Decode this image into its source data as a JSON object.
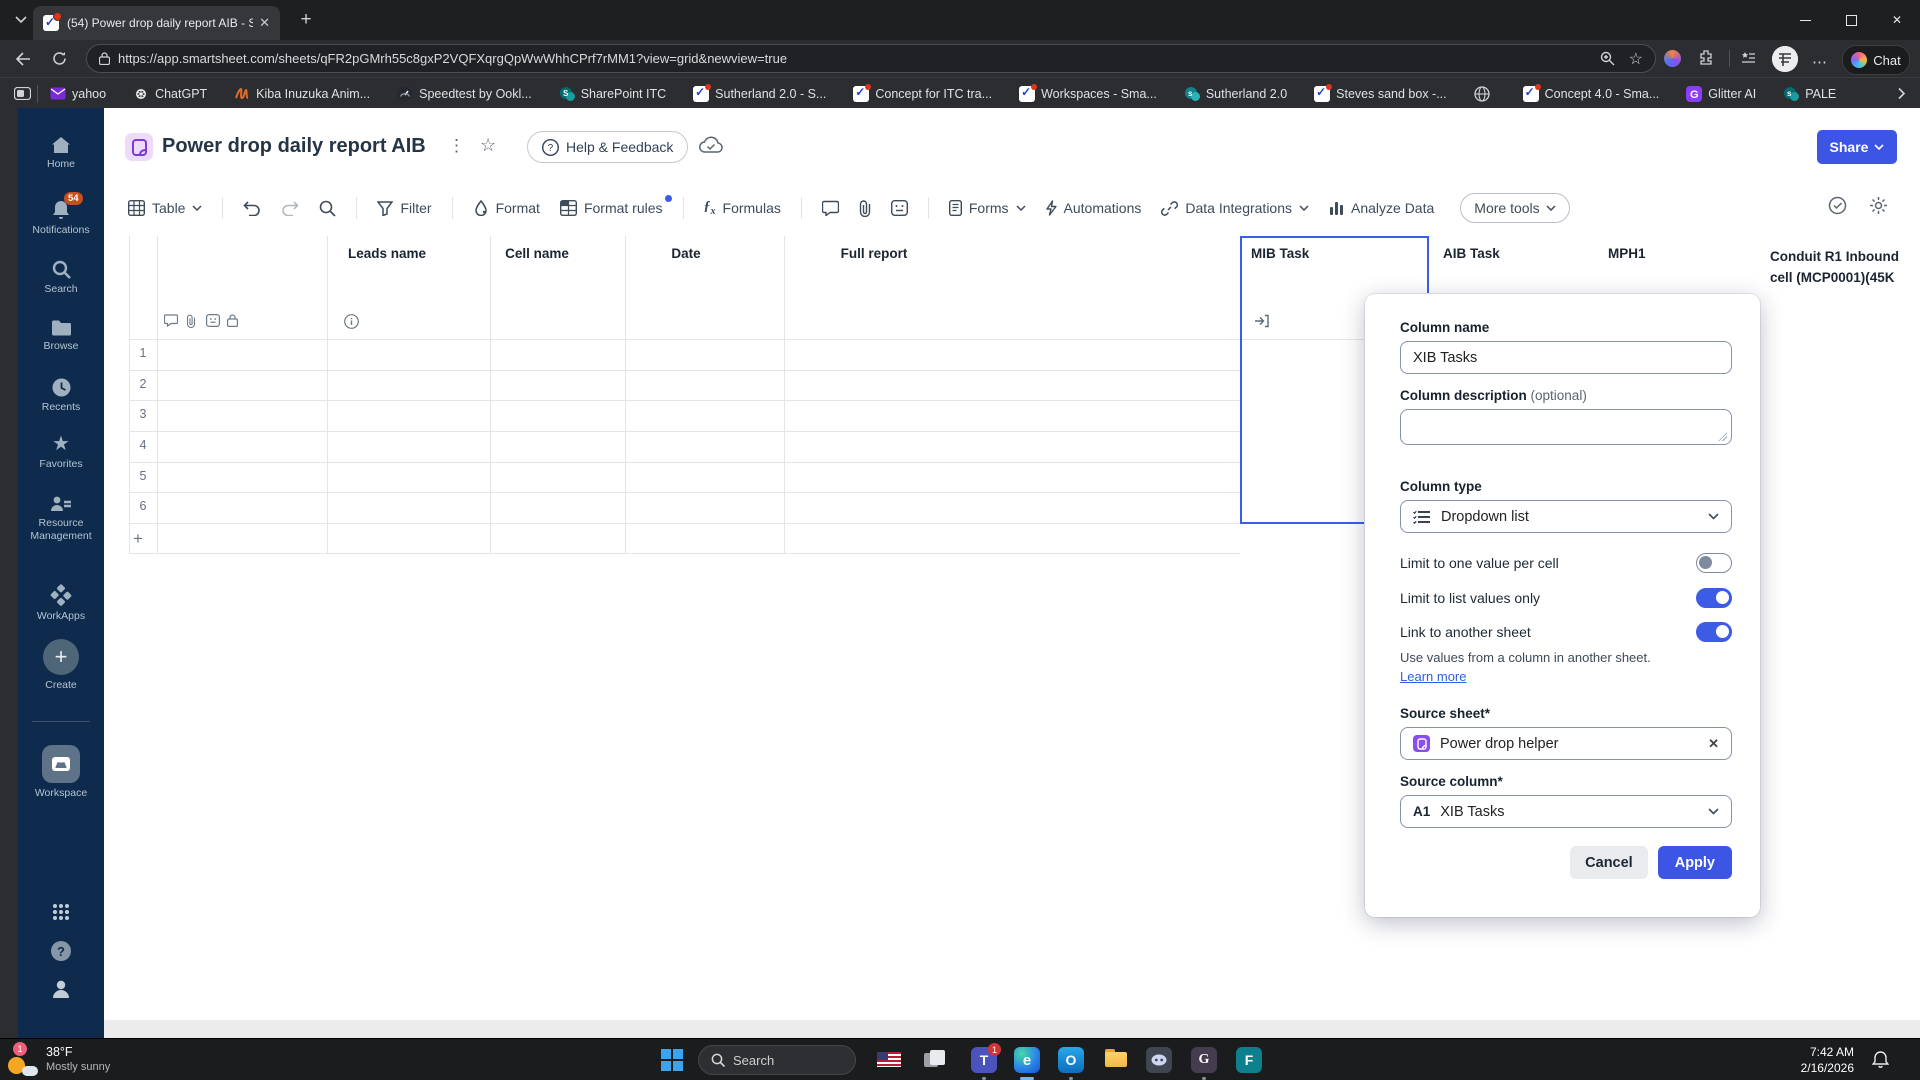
{
  "browser": {
    "tab_title": "(54) Power drop daily report AIB - S",
    "url": "https://app.smartsheet.com/sheets/qFR2pGMrh55c8gxP2VQFXqrgQpWwWhhCPrf7rMM1?view=grid&newview=true",
    "chat_label": "Chat",
    "bookmarks": [
      {
        "label": "yahoo"
      },
      {
        "label": "ChatGPT"
      },
      {
        "label": "Kiba Inuzuka Anim..."
      },
      {
        "label": "Speedtest by Ookl..."
      },
      {
        "label": "SharePoint ITC"
      },
      {
        "label": "Sutherland 2.0 - S..."
      },
      {
        "label": "Concept for ITC tra..."
      },
      {
        "label": "Workspaces - Sma..."
      },
      {
        "label": "Sutherland 2.0"
      },
      {
        "label": "Steves sand box -..."
      },
      {
        "label": ""
      },
      {
        "label": "Concept 4.0 - Sma..."
      },
      {
        "label": "Glitter AI"
      },
      {
        "label": "PALE"
      }
    ]
  },
  "sidebar": {
    "notification_count": "54",
    "items": [
      {
        "label": "Home"
      },
      {
        "label": "Notifications"
      },
      {
        "label": "Search"
      },
      {
        "label": "Browse"
      },
      {
        "label": "Recents"
      },
      {
        "label": "Favorites"
      },
      {
        "label": "Resource Management"
      },
      {
        "label": "WorkApps"
      },
      {
        "label": "Create"
      },
      {
        "label": "Workspace"
      }
    ]
  },
  "header": {
    "title": "Power drop daily report AIB",
    "help_feedback_label": "Help & Feedback",
    "share_label": "Share"
  },
  "toolbar": {
    "table_label": "Table",
    "filter_label": "Filter",
    "format_label": "Format",
    "format_rules_label": "Format rules",
    "formulas_label": "Formulas",
    "forms_label": "Forms",
    "automations_label": "Automations",
    "data_integrations_label": "Data Integrations",
    "analyze_data_label": "Analyze Data",
    "more_tools_label": "More tools"
  },
  "grid": {
    "columns": [
      "Leads name",
      "Cell name",
      "Date",
      "Full report",
      "MIB Task",
      "AIB Task",
      "MPH1",
      "Conduit R1 Inbound cell (MCP0001)(45K"
    ],
    "selected_column": "MIB Task",
    "row_numbers": [
      "1",
      "2",
      "3",
      "4",
      "5",
      "6"
    ],
    "add_row_label": "+"
  },
  "dialog": {
    "column_name_label": "Column name",
    "column_name_value": "XIB Tasks",
    "column_description_label": "Column description",
    "column_description_optional": "(optional)",
    "column_description_value": "",
    "column_type_label": "Column type",
    "column_type_value": "Dropdown list",
    "limit_one_label": "Limit to one value per cell",
    "limit_one_on": false,
    "limit_list_label": "Limit to list values only",
    "limit_list_on": true,
    "link_sheet_label": "Link to another sheet",
    "link_sheet_on": true,
    "link_sheet_help": "Use values from a column in another sheet.",
    "learn_more_label": "Learn more",
    "source_sheet_label": "Source sheet*",
    "source_sheet_value": "Power drop helper",
    "source_column_label": "Source column*",
    "source_column_badge": "A1",
    "source_column_value": "XIB Tasks",
    "cancel_label": "Cancel",
    "apply_label": "Apply"
  },
  "taskbar": {
    "temperature": "38°F",
    "condition": "Mostly sunny",
    "weather_badge": "1",
    "search_placeholder": "Search",
    "teams_badge": "1",
    "time": "7:42 AM",
    "date": "2/16/2026"
  },
  "colors": {
    "accent_blue": "#3c55e5",
    "sidebar_navy": "#0e2b4d",
    "selection_blue": "#3a5fe5",
    "notification_badge": "#c94f1d"
  }
}
